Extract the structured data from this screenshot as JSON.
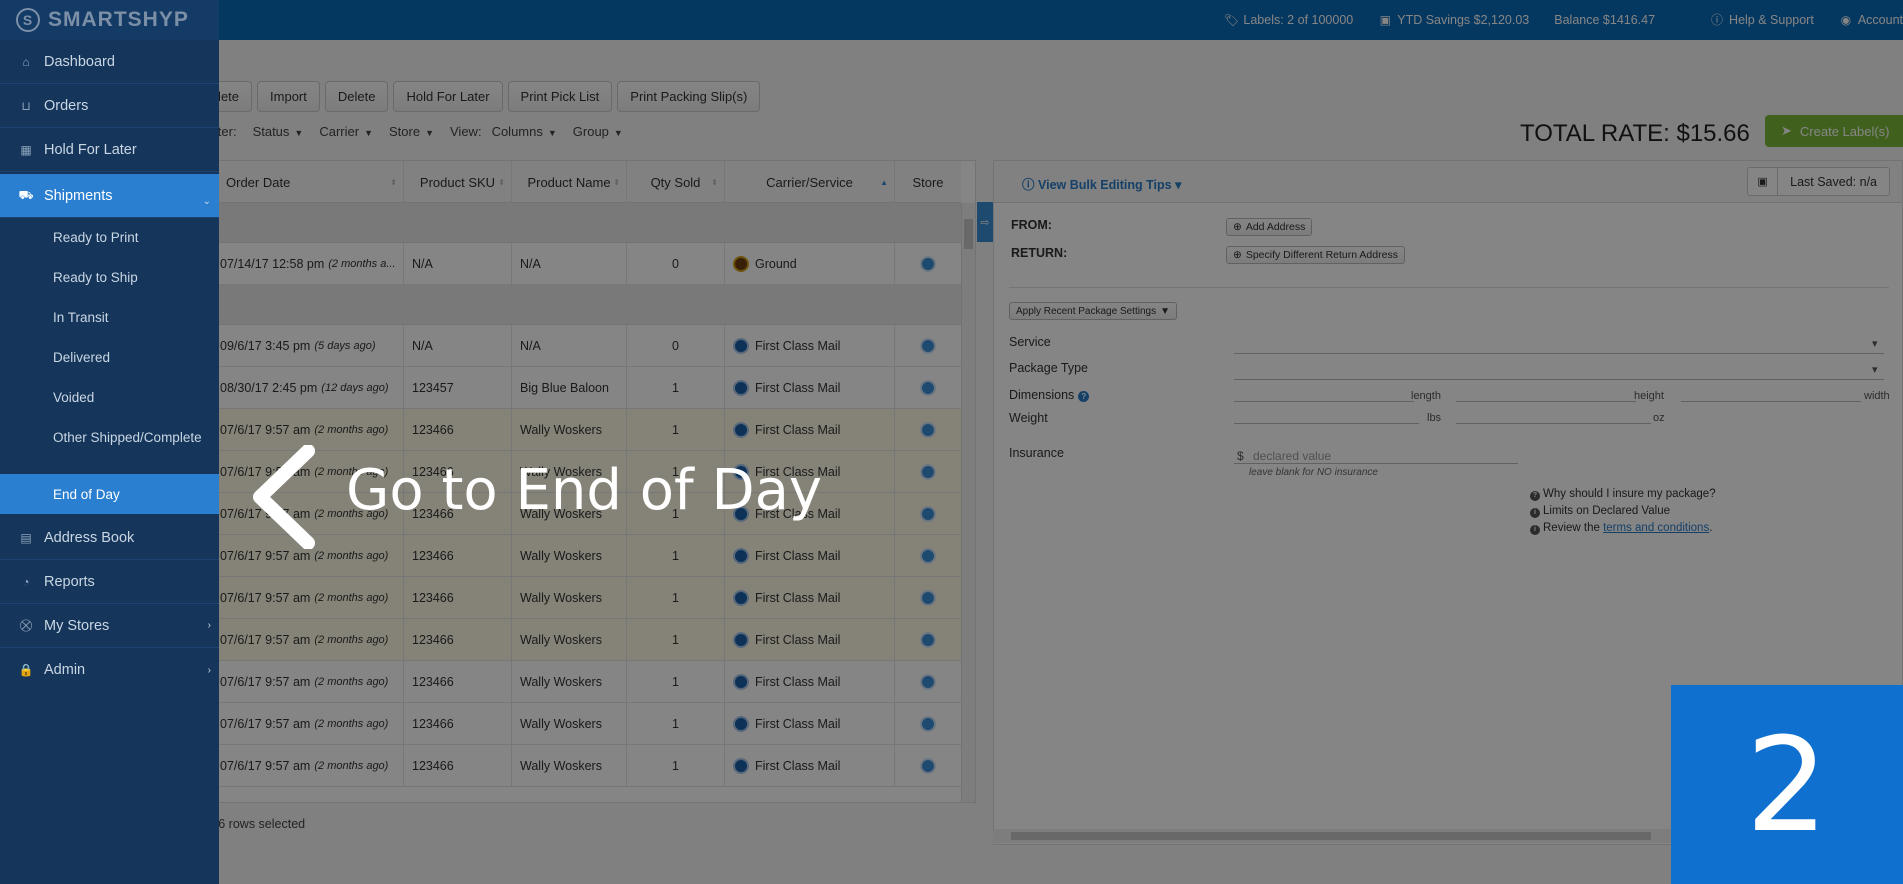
{
  "header": {
    "labels": "Labels: 2 of 100000",
    "ytd_savings": "YTD Savings $2,120.03",
    "balance": "Balance $1416.47",
    "help": "Help & Support",
    "account": "Account"
  },
  "sidebar": {
    "logo": "SMARTSHYP",
    "items": [
      {
        "label": "Dashboard",
        "icon": "home-icon"
      },
      {
        "label": "Orders",
        "icon": "basket-icon"
      },
      {
        "label": "Hold For Later",
        "icon": "calendar-icon"
      },
      {
        "label": "Shipments",
        "icon": "truck-icon"
      },
      {
        "label": "Address Book",
        "icon": "contacts-icon"
      },
      {
        "label": "Reports",
        "icon": "pie-chart-icon"
      },
      {
        "label": "My Stores",
        "icon": "cart-icon"
      },
      {
        "label": "Admin",
        "icon": "lock-icon"
      }
    ],
    "sub_items": [
      "Ready to Print",
      "Ready to Ship",
      "In Transit",
      "Delivered",
      "Voided",
      "Other Shipped/Complete",
      "End of Day"
    ]
  },
  "toolbar": {
    "buttons": [
      "mplete",
      "Import",
      "Delete",
      "Hold For Later",
      "Print Pick List",
      "Print Packing Slip(s)"
    ],
    "filter_label": "ilter:",
    "filters": [
      "Status",
      "Carrier",
      "Store"
    ],
    "view_label": "View:",
    "view_options": [
      "Columns",
      "Group"
    ]
  },
  "total_rate": "TOTAL RATE: $15.66",
  "create_label": "Create Label(s)",
  "grid": {
    "columns": [
      "Order Date",
      "Product SKU",
      "Product Name",
      "Qty Sold",
      "Carrier/Service",
      "Store"
    ],
    "rows": [
      {
        "date": "07/14/17 12:58 pm",
        "ago": "(2 months a...",
        "sku": "N/A",
        "name": "N/A",
        "qty": "0",
        "carrier": "Ground",
        "carrier_icon": "ups",
        "group_before": true
      },
      {
        "date": "09/6/17 3:45 pm",
        "ago": "(5 days ago)",
        "sku": "N/A",
        "name": "N/A",
        "qty": "0",
        "carrier": "First Class Mail",
        "carrier_icon": "usps",
        "group_before": true
      },
      {
        "date": "08/30/17 2:45 pm",
        "ago": "(12 days ago)",
        "sku": "123457",
        "name": "Big Blue Baloon",
        "qty": "1",
        "carrier": "First Class Mail",
        "carrier_icon": "usps"
      },
      {
        "date": "07/6/17 9:57 am",
        "ago": "(2 months ago)",
        "sku": "123466",
        "name": "Wally Woskers",
        "qty": "1",
        "carrier": "First Class Mail",
        "carrier_icon": "usps"
      },
      {
        "date": "07/6/17 9:57 am",
        "ago": "(2 months ago)",
        "sku": "123466",
        "name": "Wally Woskers",
        "qty": "1",
        "carrier": "First Class Mail",
        "carrier_icon": "usps"
      },
      {
        "date": "07/6/17 9:57 am",
        "ago": "(2 months ago)",
        "sku": "123466",
        "name": "Wally Woskers",
        "qty": "1",
        "carrier": "First Class Mail",
        "carrier_icon": "usps"
      },
      {
        "date": "07/6/17 9:57 am",
        "ago": "(2 months ago)",
        "sku": "123466",
        "name": "Wally Woskers",
        "qty": "1",
        "carrier": "First Class Mail",
        "carrier_icon": "usps"
      },
      {
        "date": "07/6/17 9:57 am",
        "ago": "(2 months ago)",
        "sku": "123466",
        "name": "Wally Woskers",
        "qty": "1",
        "carrier": "First Class Mail",
        "carrier_icon": "usps"
      },
      {
        "date": "07/6/17 9:57 am",
        "ago": "(2 months ago)",
        "sku": "123466",
        "name": "Wally Woskers",
        "qty": "1",
        "carrier": "First Class Mail",
        "carrier_icon": "usps"
      },
      {
        "date": "07/6/17 9:57 am",
        "ago": "(2 months ago)",
        "sku": "123466",
        "name": "Wally Woskers",
        "qty": "1",
        "carrier": "First Class Mail",
        "carrier_icon": "usps"
      },
      {
        "date": "07/6/17 9:57 am",
        "ago": "(2 months ago)",
        "sku": "123466",
        "name": "Wally Woskers",
        "qty": "1",
        "carrier": "First Class Mail",
        "carrier_icon": "usps"
      },
      {
        "date": "07/6/17 9:57 am",
        "ago": "(2 months ago)",
        "sku": "123466",
        "name": "Wally Woskers",
        "qty": "1",
        "carrier": "First Class Mail",
        "carrier_icon": "usps"
      }
    ],
    "footer_prefix": "s",
    "rows_selected": "6 rows selected"
  },
  "panel": {
    "bulk_tips": "View Bulk Editing Tips",
    "last_saved": "Last Saved: n/a",
    "from": "FROM:",
    "return": "RETURN:",
    "add_address": "Add Address",
    "specify_return": "Specify Different Return Address",
    "apply_recent": "Apply Recent Package Settings",
    "service": "Service",
    "package_type": "Package Type",
    "dimensions": "Dimensions",
    "weight": "Weight",
    "length": "length",
    "height": "height",
    "width": "width",
    "lbs": "lbs",
    "oz": "oz",
    "insurance": "Insurance",
    "currency": "$",
    "declared_placeholder": "declared value",
    "insurance_hint": "leave blank for NO insurance",
    "why_insure": "Why should I insure my package?",
    "limits": "Limits on Declared Value",
    "review": "Review the",
    "terms": "terms and conditions",
    "period": "."
  },
  "tutorial": {
    "text": "Go to End of Day",
    "step": "2"
  }
}
